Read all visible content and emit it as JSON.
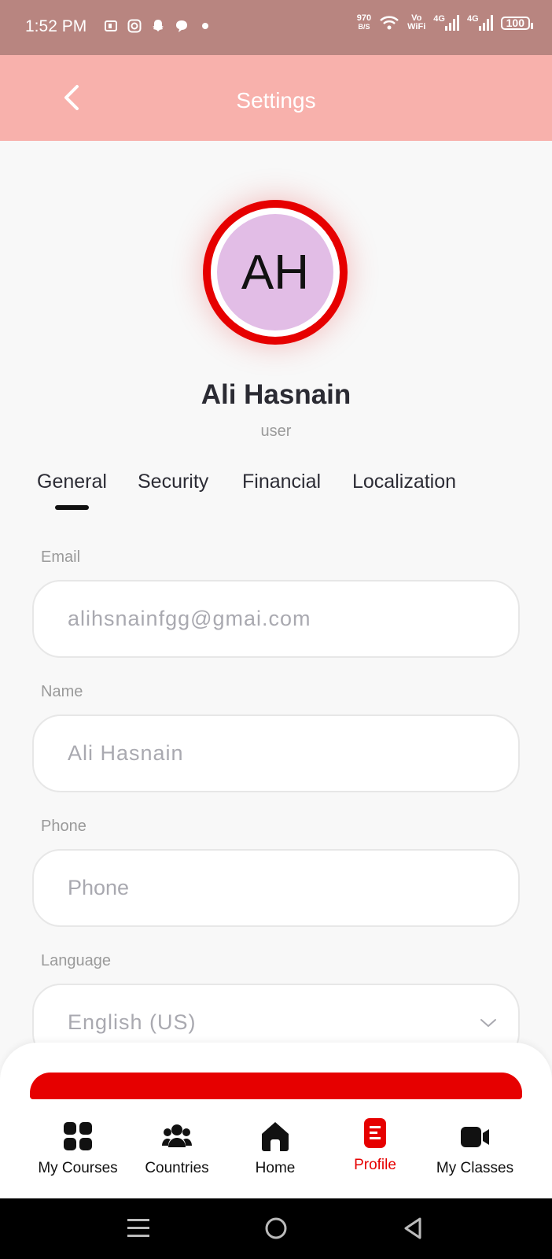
{
  "status_bar": {
    "time": "1:52 PM",
    "net_speed": "970",
    "net_unit": "B/S",
    "vowifi_top": "Vo",
    "vowifi_bottom": "WiFi",
    "signal1": "4G",
    "signal2": "4G",
    "battery": "100"
  },
  "header": {
    "title": "Settings"
  },
  "profile": {
    "initials": "AH",
    "name": "Ali Hasnain",
    "role": "user"
  },
  "tabs": [
    {
      "label": "General",
      "active": true
    },
    {
      "label": "Security"
    },
    {
      "label": "Financial"
    },
    {
      "label": "Localization"
    }
  ],
  "form": {
    "email": {
      "label": "Email",
      "value": "alihsnainfgg@gmai.com"
    },
    "name": {
      "label": "Name",
      "value": "Ali Hasnain"
    },
    "phone": {
      "label": "Phone",
      "placeholder": "Phone"
    },
    "language": {
      "label": "Language",
      "value": "English (US)"
    }
  },
  "bottom_nav": [
    {
      "label": "My Courses",
      "icon": "grid-icon"
    },
    {
      "label": "Countries",
      "icon": "users-icon"
    },
    {
      "label": "Home",
      "icon": "home-icon"
    },
    {
      "label": "Profile",
      "icon": "document-icon",
      "active": true
    },
    {
      "label": "My Classes",
      "icon": "video-camera-icon"
    }
  ],
  "colors": {
    "accent": "#e60000",
    "header_bg": "#f8b1ac",
    "status_bg": "#b88580"
  }
}
